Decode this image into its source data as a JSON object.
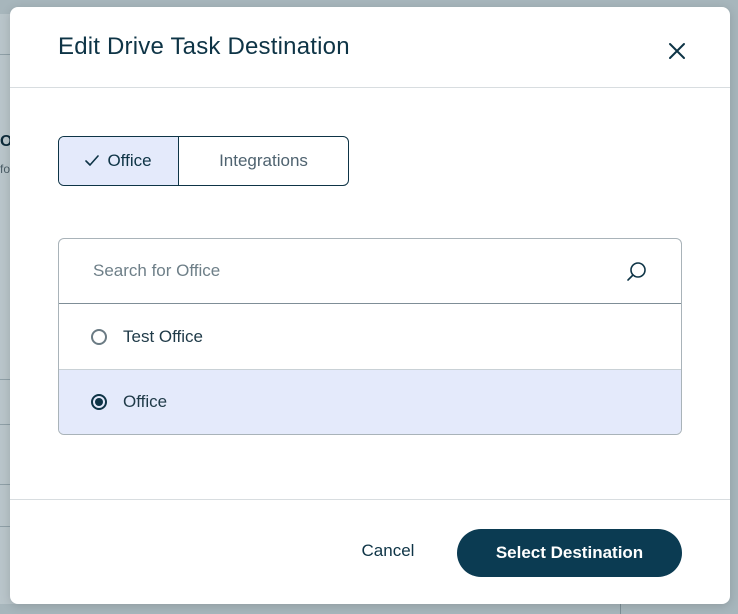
{
  "background": {
    "fragment_heading": "O",
    "fragment_text": "fo"
  },
  "dialog": {
    "title": "Edit Drive Task Destination",
    "close_icon": "close-icon",
    "tabs": [
      {
        "label": "Office",
        "selected": true,
        "icon": "check-icon"
      },
      {
        "label": "Integrations",
        "selected": false
      }
    ],
    "search": {
      "placeholder": "Search for Office",
      "value": "",
      "icon": "search-icon"
    },
    "options": [
      {
        "label": "Test Office",
        "selected": false
      },
      {
        "label": "Office",
        "selected": true
      }
    ],
    "footer": {
      "cancel_label": "Cancel",
      "primary_label": "Select Destination"
    }
  },
  "colors": {
    "brand": "#0b3b52",
    "selected_bg": "#e4eafb",
    "overlay": "#a7b6bc"
  }
}
